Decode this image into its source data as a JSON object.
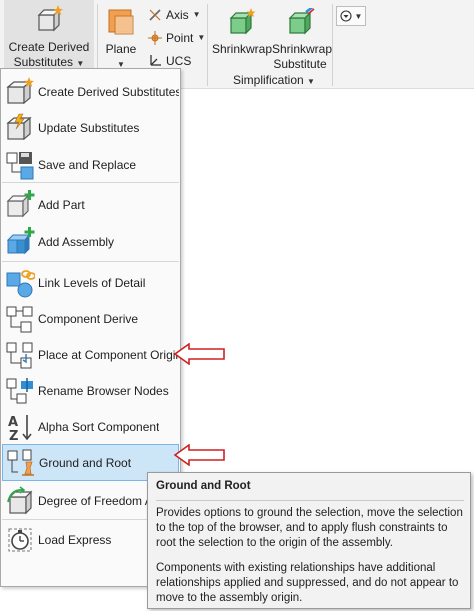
{
  "ribbon": {
    "create_derived_line1": "Create Derived",
    "create_derived_line2": "Substitutes",
    "plane_label": "Plane",
    "axis_label": "Axis",
    "point_label": "Point",
    "ucs_label": "UCS",
    "shrinkwrap_label": "Shrinkwrap",
    "shrinkwrap_sub_line1": "Shrinkwrap",
    "shrinkwrap_sub_line2": "Substitute",
    "simplification_label": "Simplification"
  },
  "menu": {
    "items": [
      {
        "label": "Create Derived Substitutes",
        "icon": "create-derived-icon"
      },
      {
        "label": "Update Substitutes",
        "icon": "update-substitutes-icon"
      },
      {
        "label": "Save and Replace",
        "icon": "save-replace-icon"
      },
      {
        "label": "Add Part",
        "icon": "add-part-icon"
      },
      {
        "label": "Add Assembly",
        "icon": "add-assembly-icon"
      },
      {
        "label": "Link Levels of Detail",
        "icon": "link-lod-icon"
      },
      {
        "label": "Component Derive",
        "icon": "component-derive-icon"
      },
      {
        "label": "Place at Component Origin",
        "icon": "place-origin-icon"
      },
      {
        "label": "Rename Browser Nodes",
        "icon": "rename-nodes-icon"
      },
      {
        "label": "Alpha Sort Component",
        "icon": "alpha-sort-icon"
      },
      {
        "label": "Ground and Root",
        "icon": "ground-root-icon"
      },
      {
        "label": "Degree of Freedom Analysis",
        "icon": "dof-icon"
      },
      {
        "label": "Load Express",
        "icon": "load-express-icon"
      }
    ]
  },
  "tooltip": {
    "title": "Ground and Root",
    "paragraph1": "Provides options to ground the selection, move the selection to the top of the browser, and to apply flush constraints to root the selection to the origin of the assembly.",
    "paragraph2": "Components with existing relationships have additional relationships applied and suppressed, and do not appear to move to the assembly origin."
  },
  "colors": {
    "accent_orange": "#f0a050",
    "highlight_blue": "#cde6f7",
    "highlight_border": "#7eb4ea",
    "annotation_red": "#d02020",
    "icon_green": "#3aa64a",
    "icon_blue": "#2e8fd6"
  }
}
